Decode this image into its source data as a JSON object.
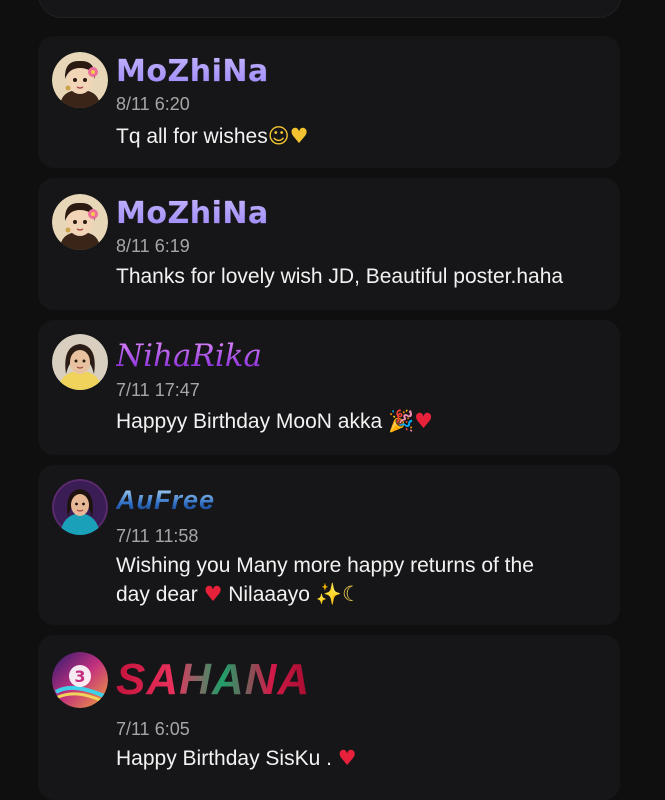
{
  "comments": [
    {
      "author": "MoZhiNa",
      "timestamp": "8/11 6:20",
      "text": "Tq all for wishes",
      "emojis": [
        "☺",
        "♥"
      ],
      "avatar_icon": "girl-with-flower-avatar"
    },
    {
      "author": "MoZhiNa",
      "timestamp": "8/11 6:19",
      "text": "Thanks for lovely wish JD, Beautiful poster.haha",
      "emojis": [],
      "avatar_icon": "girl-with-flower-avatar"
    },
    {
      "author": "NihaRika",
      "timestamp": "7/11 17:47",
      "text": "Happyy Birthday MooN akka ",
      "emojis": [
        "🎉",
        "♥"
      ],
      "avatar_icon": "woman-photo-avatar"
    },
    {
      "author": "AuFree",
      "timestamp": "7/11 11:58",
      "text_line1": "Wishing you Many more happy returns of the",
      "text_line2_a": "day dear ",
      "text_line2_b": " Nilaaayo ",
      "emojis": [
        "♥",
        "✨",
        "☾"
      ],
      "avatar_icon": "woman-blue-saree-avatar"
    },
    {
      "author": "SAHANA",
      "timestamp": "7/11 6:05",
      "text": "Happy Birthday SisKu . ",
      "emojis": [
        "♥"
      ],
      "avatar_icon": "colorful-number-3-avatar"
    }
  ],
  "colors": {
    "background": "#0f0f10",
    "card": "#161618",
    "timestamp": "#a6a6a6",
    "heart_red": "#e8213a",
    "heart_yellow": "#f2c231"
  }
}
